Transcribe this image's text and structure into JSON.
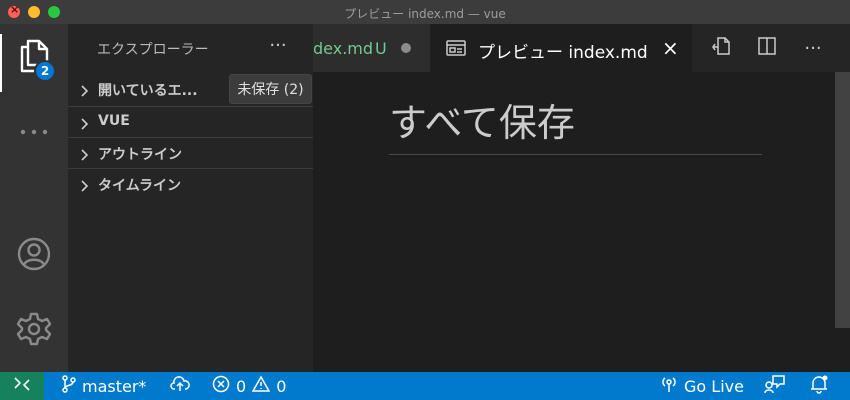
{
  "window": {
    "title": "プレビュー index.md — vue"
  },
  "activity_bar": {
    "items": [
      {
        "name": "explorer",
        "icon": "files-icon",
        "active": true,
        "badge": "2"
      },
      {
        "name": "more",
        "icon": "ellipsis-icon"
      },
      {
        "name": "accounts",
        "icon": "account-icon"
      },
      {
        "name": "manage",
        "icon": "gear-icon"
      }
    ]
  },
  "sidebar": {
    "title": "エクスプローラー",
    "more_label": "···",
    "sections": [
      {
        "label": "開いているエ...",
        "collapsed": true
      },
      {
        "label": "VUE",
        "collapsed": true
      },
      {
        "label": "アウトライン",
        "collapsed": true
      },
      {
        "label": "タイムライン",
        "collapsed": true
      }
    ],
    "tooltip": "未保存 (2)"
  },
  "tabs": [
    {
      "label": "dex.md",
      "status": "U",
      "dirty": true,
      "color": "#73c991"
    },
    {
      "label": "プレビュー index.md",
      "icon": "preview-icon",
      "active": true
    }
  ],
  "editor_actions": [
    {
      "name": "open-source-icon"
    },
    {
      "name": "split-editor-icon"
    },
    {
      "name": "more-actions-icon",
      "label": "···"
    }
  ],
  "preview": {
    "heading": "すべて保存"
  },
  "statusbar": {
    "background": "#007acc",
    "remote_background": "#16825d",
    "branch": "master*",
    "errors": "0",
    "warnings": "0",
    "go_live": "Go Live"
  }
}
